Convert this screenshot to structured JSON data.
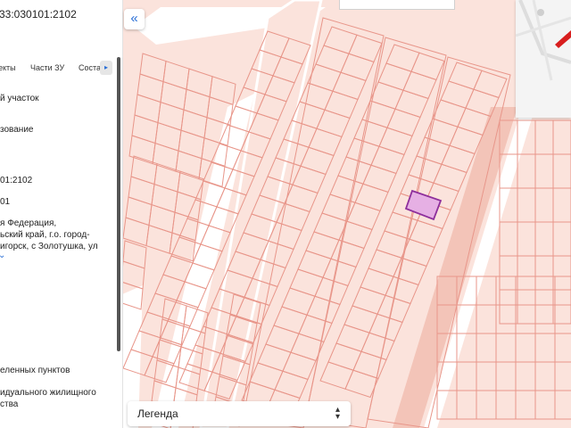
{
  "panel": {
    "cad_number_partial": "33:030101:2102",
    "tabs": [
      "екты",
      "Части ЗУ",
      "Состав"
    ],
    "tab_scroll_glyph": "▸",
    "lines": [
      "й участок",
      "зование",
      "01:2102",
      "01",
      "я Федерация,",
      "ьский край, г.о. город-",
      "игорск, с Золотушка, ул",
      "еленных пунктов",
      "идуального жилищного",
      "ства"
    ],
    "chevron": "⌄"
  },
  "collapse_button": {
    "label": "«"
  },
  "legend": {
    "label": "Легенда",
    "icon": "chevron-updown-icon"
  },
  "colors": {
    "map_background": "#fbe3dc",
    "parcel_stroke": "#e8968a",
    "road": "#ffffff",
    "selected_parcel_fill": "#e6b0e4",
    "selected_parcel_stroke": "#8e2f9c",
    "accent": "#2a6fd6"
  }
}
